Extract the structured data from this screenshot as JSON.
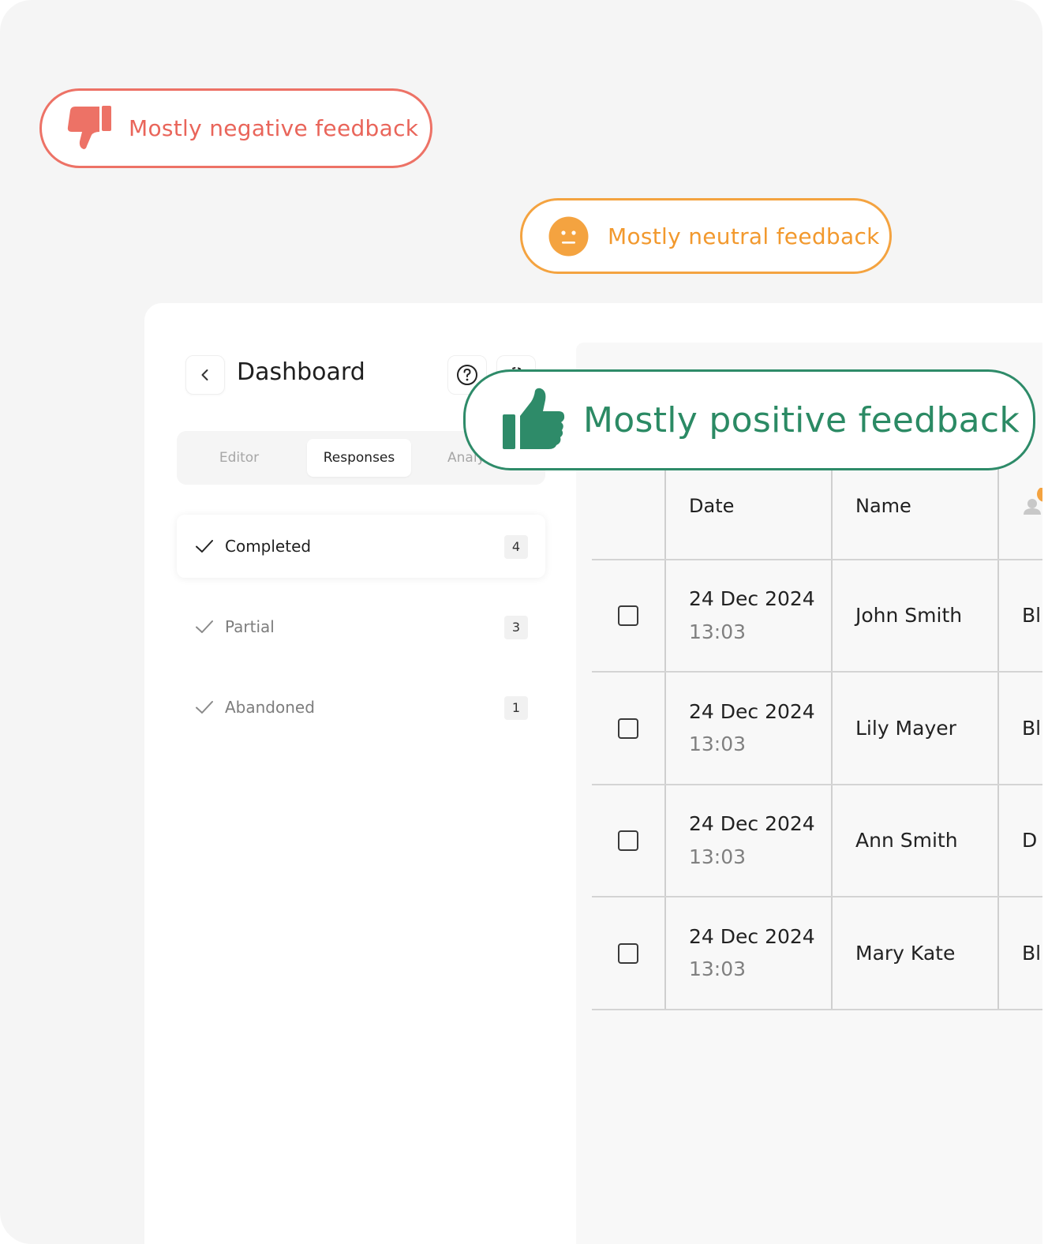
{
  "badges": {
    "negative": {
      "label": "Mostly negative feedback",
      "icon": "thumbs-down-icon",
      "color": "#e9655a"
    },
    "neutral": {
      "label": "Mostly neutral feedback",
      "icon": "neutral-face-icon",
      "color": "#f2992e"
    },
    "positive": {
      "label": "Mostly positive feedback",
      "icon": "thumbs-up-icon",
      "color": "#2b8a64"
    }
  },
  "sidebar": {
    "title": "Dashboard",
    "tabs": [
      {
        "label": "Editor"
      },
      {
        "label": "Responses",
        "active": true
      },
      {
        "label": "Analy"
      }
    ],
    "statuses": [
      {
        "label": "Completed",
        "count": "4",
        "active": true
      },
      {
        "label": "Partial",
        "count": "3"
      },
      {
        "label": "Abandoned",
        "count": "1"
      }
    ]
  },
  "table": {
    "headers": {
      "date": "Date",
      "name": "Name"
    },
    "rows": [
      {
        "date": "24 Dec 2024",
        "time": "13:03",
        "name": "John Smith",
        "extra": "Bl"
      },
      {
        "date": "24 Dec 2024",
        "time": "13:03",
        "name": "Lily Mayer",
        "extra": "Bl"
      },
      {
        "date": "24 Dec 2024",
        "time": "13:03",
        "name": "Ann Smith",
        "extra": "D"
      },
      {
        "date": "24 Dec 2024",
        "time": "13:03",
        "name": "Mary Kate",
        "extra": "Bl"
      }
    ]
  }
}
